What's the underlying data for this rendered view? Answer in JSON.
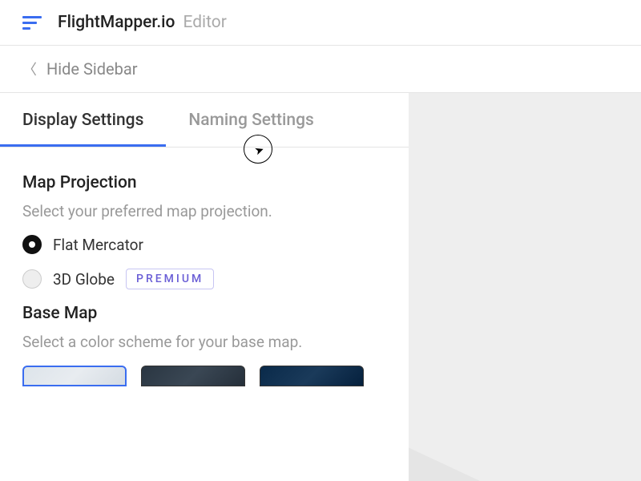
{
  "header": {
    "app_name": "FlightMapper.io",
    "mode": "Editor"
  },
  "sidebar": {
    "hide_label": "Hide Sidebar",
    "tabs": [
      {
        "label": "Display Settings",
        "active": true
      },
      {
        "label": "Naming Settings",
        "active": false
      }
    ]
  },
  "display_settings": {
    "map_projection": {
      "title": "Map Projection",
      "description": "Select your preferred map projection.",
      "options": [
        {
          "label": "Flat Mercator",
          "selected": true,
          "badge": null
        },
        {
          "label": "3D Globe",
          "selected": false,
          "badge": "PREMIUM"
        }
      ]
    },
    "base_map": {
      "title": "Base Map",
      "description": "Select a color scheme for your base map.",
      "options": [
        {
          "scheme": "light",
          "selected": true
        },
        {
          "scheme": "dark-grey",
          "selected": false
        },
        {
          "scheme": "dark-blue",
          "selected": false
        }
      ]
    }
  }
}
